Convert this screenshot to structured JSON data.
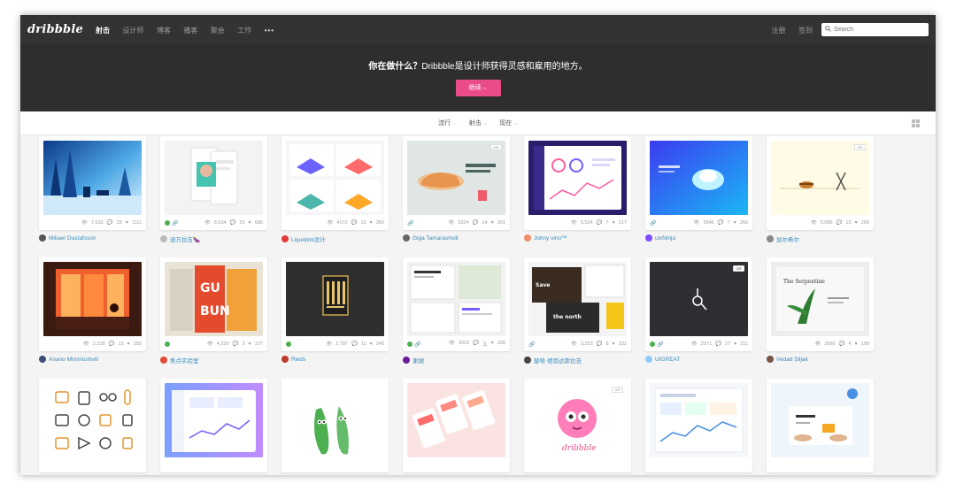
{
  "header": {
    "logo": "dribbble",
    "nav": [
      "射击",
      "设计师",
      "博客",
      "播客",
      "聚会",
      "工作"
    ],
    "more": "•••",
    "signup": "注册",
    "signin": "签到",
    "search_placeholder": "Search"
  },
  "hero": {
    "question": "你在做什么？",
    "text": "Dribbble是设计师获得灵感和雇用的地方。",
    "button": "继续→"
  },
  "filters": [
    "流行",
    "射击",
    "现在"
  ],
  "colors": {
    "accent": "#ea4c89",
    "link": "#3a8bbb",
    "topbar": "#333333",
    "hero": "#2e2e2e"
  },
  "shots": [
    {
      "views": "7,632",
      "comments": "33",
      "likes": "1111",
      "user": "Mikael Gustafsson",
      "gif": false,
      "link": false,
      "rebound": false
    },
    {
      "views": "8,534",
      "comments": "25",
      "likes": "686",
      "user": "迪万拉吉🍆",
      "gif": false,
      "link": true,
      "rebound": true
    },
    {
      "views": "4172",
      "comments": "15",
      "likes": "350",
      "user": "Liquidink设计",
      "gif": false,
      "link": false,
      "rebound": false
    },
    {
      "views": "5324",
      "comments": "14",
      "likes": "301",
      "user": "Giga Tamarashvili",
      "gif": true,
      "link": true,
      "rebound": false
    },
    {
      "views": "5,524",
      "comments": "7",
      "likes": "217",
      "user": "Johny vino™",
      "gif": false,
      "link": false,
      "rebound": false
    },
    {
      "views": "3945",
      "comments": "7",
      "likes": "266",
      "user": "uixNinja",
      "gif": false,
      "link": true,
      "rebound": false
    },
    {
      "views": "5,085",
      "comments": "13",
      "likes": "260",
      "user": "加尔希尔",
      "gif": true,
      "link": false,
      "rebound": false
    },
    {
      "views": "2,218",
      "comments": "13",
      "likes": "250",
      "user": "Anano Miminoshvili",
      "gif": false,
      "link": false,
      "rebound": false
    },
    {
      "views": "4,226",
      "comments": "3",
      "likes": "227",
      "user": "焦点实验室",
      "gif": false,
      "link": false,
      "rebound": true
    },
    {
      "views": "2,787",
      "comments": "11",
      "likes": "245",
      "user": "Rwds",
      "gif": false,
      "link": false,
      "rebound": true
    },
    {
      "views": "3023",
      "comments": "五",
      "likes": "209",
      "user": "谢谢",
      "gif": false,
      "link": true,
      "rebound": true
    },
    {
      "views": "3,223",
      "comments": "8",
      "likes": "232",
      "user": "瑟哈·德恩达斯拉吉",
      "gif": false,
      "link": true,
      "rebound": false
    },
    {
      "views": "2371",
      "comments": "27",
      "likes": "211",
      "user": "UIGREAT",
      "gif": true,
      "link": true,
      "rebound": true
    },
    {
      "views": "2560",
      "comments": "4",
      "likes": "199",
      "user": "Vedad Siljak",
      "gif": false,
      "link": false,
      "rebound": false
    },
    {
      "gif": false
    },
    {
      "gif": false
    },
    {
      "gif": false
    },
    {
      "gif": false
    },
    {
      "gif": true
    },
    {
      "gif": false
    },
    {
      "gif": false
    }
  ],
  "icons": {
    "views": "eye-icon",
    "comments": "comment-icon",
    "likes": "heart-icon",
    "search": "search-icon",
    "grid": "grid-view-icon"
  }
}
